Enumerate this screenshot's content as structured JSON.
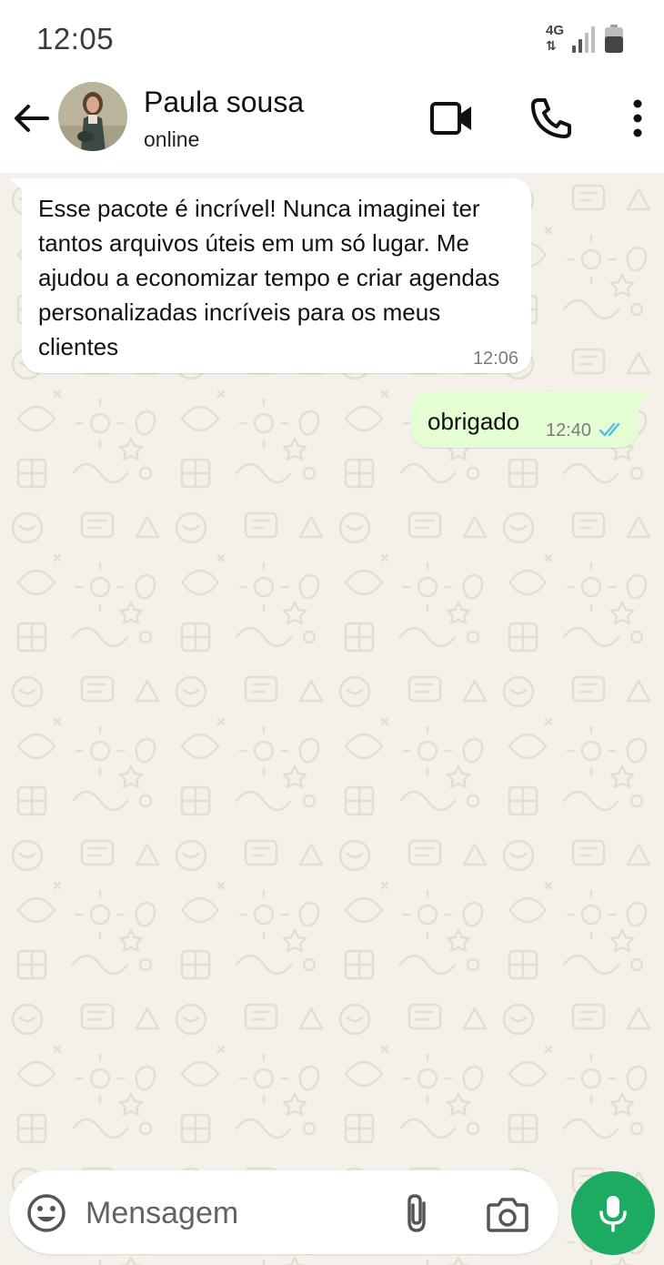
{
  "status_bar": {
    "time": "12:05",
    "network": "4G",
    "icons": [
      "network-arrows-icon",
      "signal-icon",
      "battery-icon"
    ]
  },
  "header": {
    "contact_name": "Paula sousa",
    "contact_status": "online",
    "icons": [
      "back-arrow-icon",
      "avatar",
      "video-call-icon",
      "phone-icon",
      "more-vert-icon"
    ]
  },
  "messages": [
    {
      "direction": "incoming",
      "text": "Esse pacote é incrível! Nunca imaginei ter tantos arquivos úteis em um só lugar. Me ajudou a economizar tempo e criar agendas personalizadas incríveis para os meus clientes",
      "time": "12:06"
    },
    {
      "direction": "outgoing",
      "text": "obrigado",
      "time": "12:40",
      "status": "read"
    }
  ],
  "composer": {
    "placeholder": "Mensagem",
    "value": "",
    "icons": [
      "emoji-icon",
      "attach-icon",
      "camera-icon",
      "mic-icon"
    ]
  },
  "colors": {
    "header_bg": "#ffffff",
    "chat_bg": "#f4f1ea",
    "incoming_bubble": "#ffffff",
    "outgoing_bubble": "#e4fdd3",
    "read_ticks": "#53bdeb",
    "mic_button": "#1daa61"
  }
}
